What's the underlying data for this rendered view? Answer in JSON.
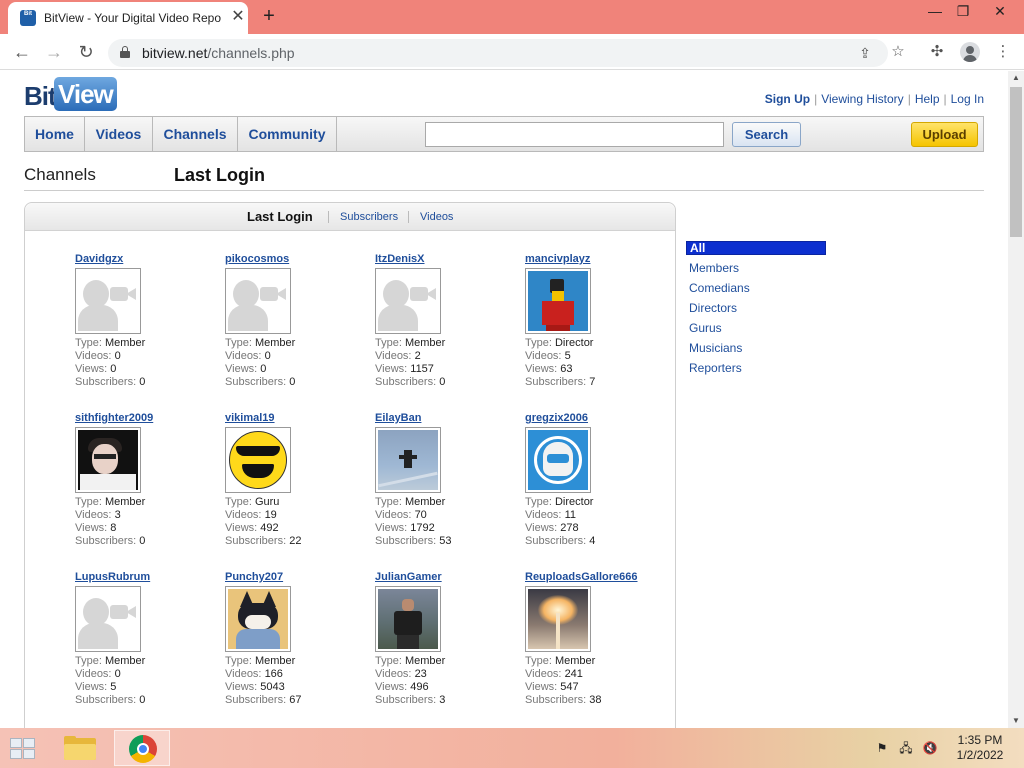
{
  "browser": {
    "tab_title": "BitView - Your Digital Video Repo",
    "favicon_text": "Bit",
    "close_glyph": "✕",
    "new_tab_glyph": "+",
    "window_controls": [
      "—",
      "❐",
      "✕"
    ],
    "url_host": "bitview.net",
    "url_path": "/channels.php"
  },
  "site": {
    "logo_bit": "Bit",
    "logo_view": "View",
    "top_links": {
      "sign_up": "Sign Up",
      "viewing_history": "Viewing History",
      "help": "Help",
      "log_in": "Log In",
      "separator": "|"
    },
    "nav": [
      "Home",
      "Videos",
      "Channels",
      "Community"
    ],
    "search_value": "",
    "search_button": "Search",
    "upload_button": "Upload"
  },
  "page": {
    "section_label": "Channels",
    "title": "Last Login",
    "sort_tabs": {
      "active": "Last Login",
      "subscribers": "Subscribers",
      "videos": "Videos"
    },
    "stat_labels": {
      "type": "Type:",
      "videos": "Videos:",
      "views": "Views:",
      "subscribers": "Subscribers:"
    }
  },
  "channels": [
    {
      "name": "Davidgzx",
      "type": "Member",
      "videos": "0",
      "views": "0",
      "subscribers": "0",
      "avatar": "default"
    },
    {
      "name": "pikocosmos",
      "type": "Member",
      "videos": "0",
      "views": "0",
      "subscribers": "0",
      "avatar": "default"
    },
    {
      "name": "ItzDenisX",
      "type": "Member",
      "videos": "2",
      "views": "1157",
      "subscribers": "0",
      "avatar": "default"
    },
    {
      "name": "mancivplayz",
      "type": "Director",
      "videos": "5",
      "views": "63",
      "subscribers": "7",
      "avatar": "roblox"
    },
    {
      "name": "sithfighter2009",
      "type": "Member",
      "videos": "3",
      "views": "8",
      "subscribers": "0",
      "avatar": "photo"
    },
    {
      "name": "vikimal19",
      "type": "Guru",
      "videos": "19",
      "views": "492",
      "subscribers": "22",
      "avatar": "smiley"
    },
    {
      "name": "EilayBan",
      "type": "Member",
      "videos": "70",
      "views": "1792",
      "subscribers": "53",
      "avatar": "sky"
    },
    {
      "name": "gregzix2006",
      "type": "Director",
      "videos": "11",
      "views": "278",
      "subscribers": "4",
      "avatar": "helmet"
    },
    {
      "name": "LupusRubrum",
      "type": "Member",
      "videos": "0",
      "views": "5",
      "subscribers": "0",
      "avatar": "default"
    },
    {
      "name": "Punchy207",
      "type": "Member",
      "videos": "166",
      "views": "5043",
      "subscribers": "67",
      "avatar": "cat"
    },
    {
      "name": "JulianGamer",
      "type": "Member",
      "videos": "23",
      "views": "496",
      "subscribers": "3",
      "avatar": "soldier"
    },
    {
      "name": "ReuploadsGallore666",
      "type": "Member",
      "videos": "241",
      "views": "547",
      "subscribers": "38",
      "avatar": "burst"
    }
  ],
  "categories": {
    "active": "All",
    "items": [
      "Members",
      "Comedians",
      "Directors",
      "Gurus",
      "Musicians",
      "Reporters"
    ]
  },
  "taskbar": {
    "time": "1:35 PM",
    "date": "1/2/2022"
  },
  "colors": {
    "link": "#1f4e9b",
    "tab_strip": "#f0837a",
    "category_active": "#0c2fcf",
    "upload": "#f5c400"
  }
}
